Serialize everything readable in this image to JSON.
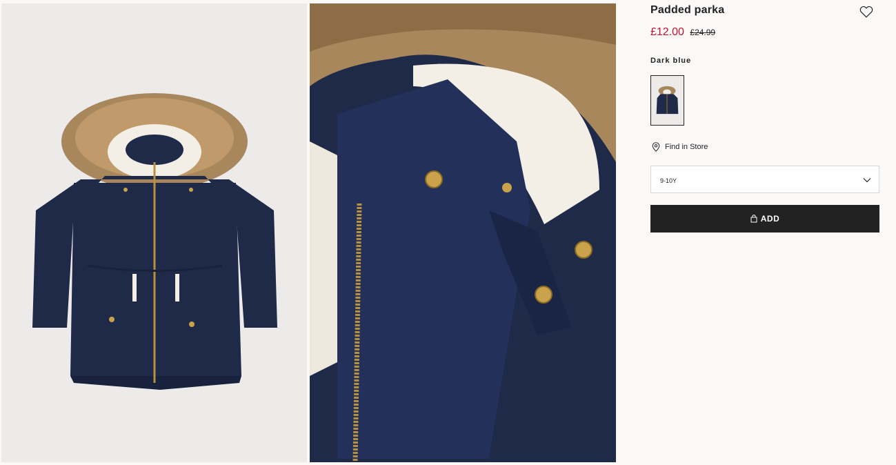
{
  "product": {
    "title": "Padded parka",
    "price_sale": "£12.00",
    "price_original": "£24.99",
    "color_name": "Dark blue",
    "find_in_store_label": "Find in Store",
    "selected_size": "9-10Y",
    "add_button_label": "ADD"
  },
  "colors": {
    "sale_red": "#c8102e",
    "button_black": "#222222",
    "parka_navy": "#1f2a48",
    "fur_tan": "#a8875c"
  },
  "icons": {
    "wishlist": "heart-outline-icon",
    "store": "map-pin-icon",
    "dropdown": "chevron-down-icon",
    "add": "shopping-bag-icon"
  }
}
